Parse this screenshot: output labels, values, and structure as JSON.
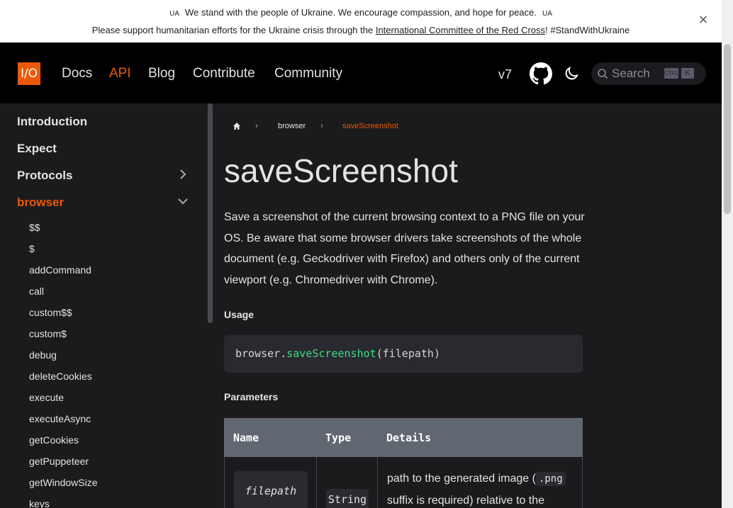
{
  "banner": {
    "flag_left": "UA",
    "line1_text": "We stand with the people of Ukraine. We encourage compassion, and hope for peace.",
    "flag_right": "UA",
    "line2_prefix": "Please support humanitarian efforts for the Ukraine crisis through the",
    "line2_link": "International Committee of the Red Cross",
    "line2_suffix": "! #StandWithUkraine",
    "close_symbol": "×"
  },
  "navbar": {
    "logo_text": "I/O",
    "links": [
      {
        "label": "Docs",
        "active": false
      },
      {
        "label": "API",
        "active": true
      },
      {
        "label": "Blog",
        "active": false
      },
      {
        "label": "Contribute",
        "active": false
      },
      {
        "label": "Community",
        "active": false
      }
    ],
    "version": "v7",
    "search_placeholder": "Search",
    "kbd_ctrl": "CTRL",
    "kbd_k": "K",
    "accent_color": "#ea5906"
  },
  "sidebar": {
    "categories": [
      {
        "label": "Introduction",
        "chevron": "none"
      },
      {
        "label": "Expect",
        "chevron": "none"
      },
      {
        "label": "Protocols",
        "chevron": "right"
      },
      {
        "label": "browser",
        "chevron": "down",
        "active": true
      }
    ],
    "items": [
      "$$",
      "$",
      "addCommand",
      "call",
      "custom$$",
      "custom$",
      "debug",
      "deleteCookies",
      "execute",
      "executeAsync",
      "getCookies",
      "getPuppeteer",
      "getWindowSize",
      "keys"
    ]
  },
  "breadcrumb": {
    "home_icon": "home-icon",
    "items": [
      "browser",
      "saveScreenshot"
    ]
  },
  "content": {
    "title": "saveScreenshot",
    "description": "Save a screenshot of the current browsing context to a PNG file on your OS. Be aware that some browser drivers take screenshots of the whole document (e.g. Geckodriver with Firefox) and others only of the current viewport (e.g. Chromedriver with Chrome).",
    "usage_heading": "Usage",
    "code": {
      "object": "browser.",
      "method": "saveScreenshot",
      "args": "(filepath)"
    },
    "params_heading": "Parameters",
    "table": {
      "headers": [
        "Name",
        "Type",
        "Details"
      ],
      "rows": [
        {
          "name": "filepath",
          "type": "String",
          "details_prefix": "path to the generated image (",
          "details_code": ".png",
          "details_suffix": " suffix is required) relative to the"
        }
      ]
    }
  }
}
